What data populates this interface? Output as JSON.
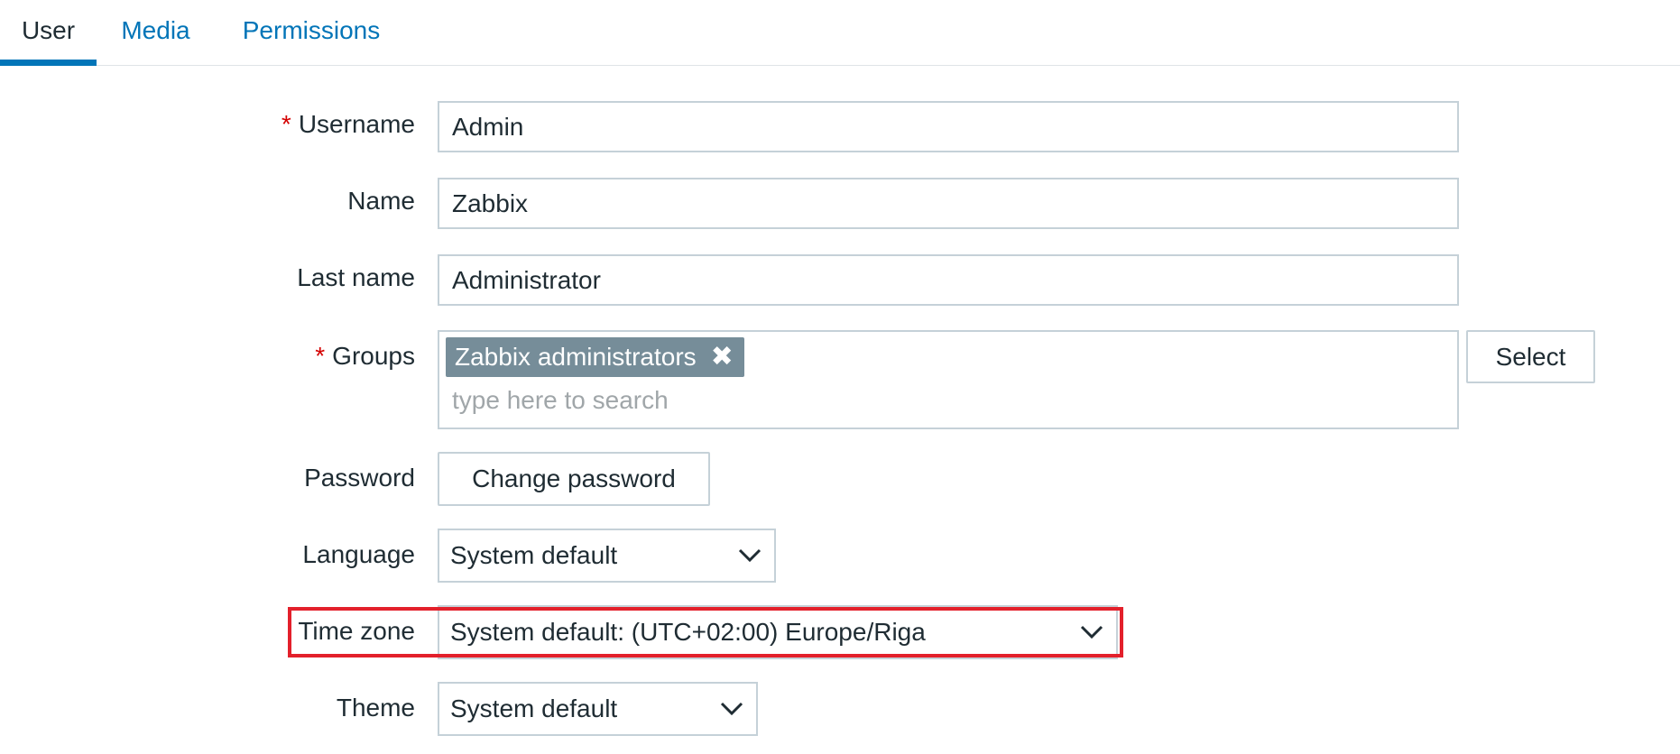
{
  "tabs": [
    {
      "label": "User",
      "active": true
    },
    {
      "label": "Media",
      "active": false
    },
    {
      "label": "Permissions",
      "active": false
    }
  ],
  "form": {
    "username": {
      "label": "Username",
      "required": true,
      "value": "Admin"
    },
    "name": {
      "label": "Name",
      "value": "Zabbix"
    },
    "last_name": {
      "label": "Last name",
      "value": "Administrator"
    },
    "groups": {
      "label": "Groups",
      "required": true,
      "selected": [
        "Zabbix administrators"
      ],
      "placeholder": "type here to search",
      "select_button": "Select"
    },
    "password": {
      "label": "Password",
      "button": "Change password"
    },
    "language": {
      "label": "Language",
      "value": "System default"
    },
    "timezone": {
      "label": "Time zone",
      "value": "System default: (UTC+02:00) Europe/Riga"
    },
    "theme": {
      "label": "Theme",
      "value": "System default"
    }
  },
  "required_marker": "*",
  "icons": {
    "chip_remove": "close-icon",
    "dropdown": "chevron-down-icon"
  },
  "colors": {
    "accent": "#0275b8",
    "chip_bg": "#768d99",
    "required": "#d40000",
    "highlight": "#e3202b",
    "border": "#c5d1d8"
  }
}
